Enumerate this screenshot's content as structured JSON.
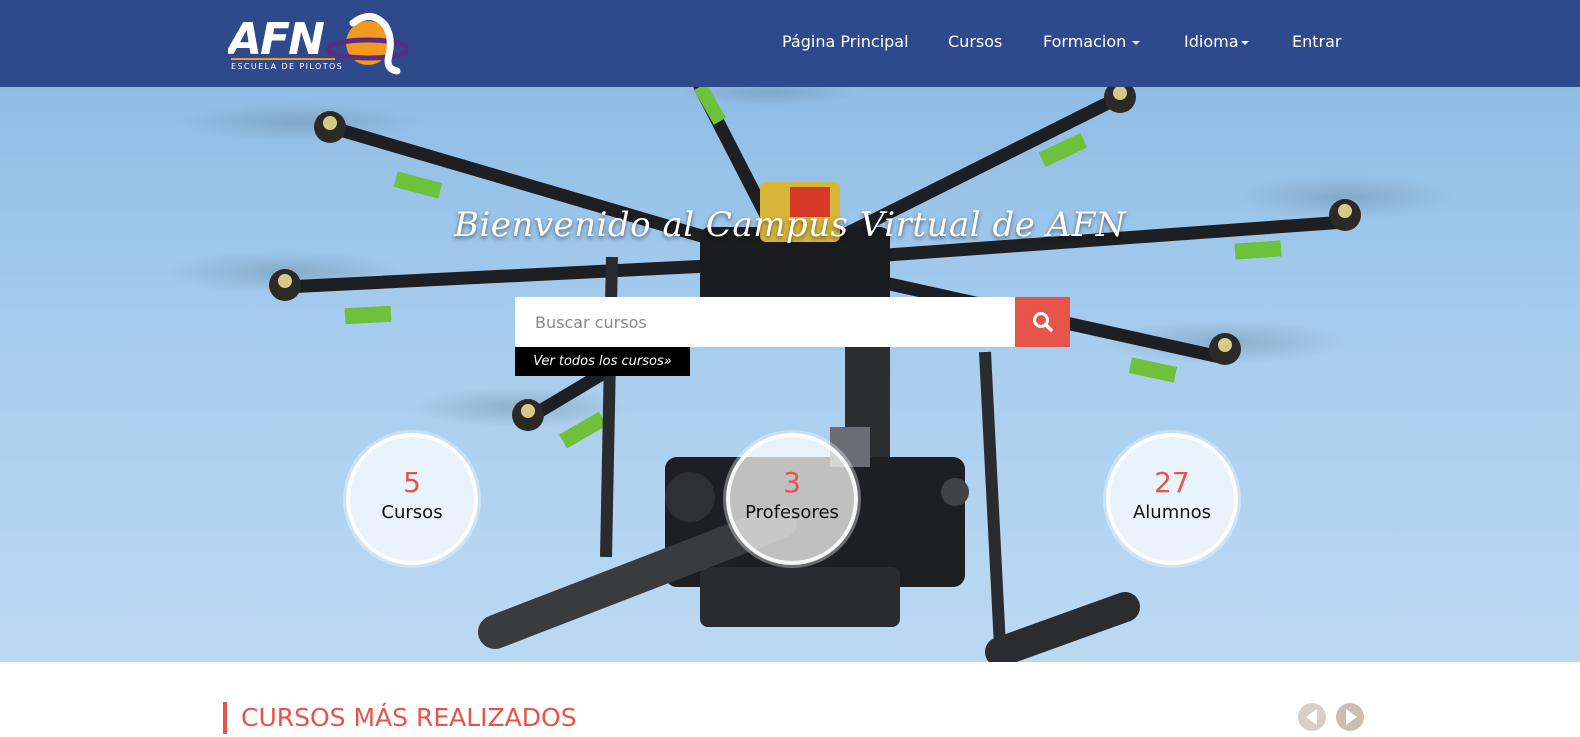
{
  "header": {
    "logo_text": "AFN",
    "logo_subtext": "ESCUELA DE PILOTOS",
    "nav": [
      {
        "label": "Página Principal"
      },
      {
        "label": "Cursos"
      },
      {
        "label": "Formacion"
      },
      {
        "label": "Idioma"
      },
      {
        "label": "Entrar"
      }
    ]
  },
  "hero": {
    "title": "Bienvenido al Campus Virtual de AFN",
    "search": {
      "placeholder": "Buscar cursos",
      "button_icon": "search-icon"
    },
    "view_all_link": "Ver todos los cursos»",
    "stats": [
      {
        "number": "5",
        "label": "Cursos"
      },
      {
        "number": "3",
        "label": "Profesores"
      },
      {
        "number": "27",
        "label": "Alumnos"
      }
    ]
  },
  "section": {
    "title": "CURSOS MÁS REALIZADOS",
    "prev_icon": "chevron-left-icon",
    "next_icon": "chevron-right-icon"
  },
  "colors": {
    "header_bg": "#2e4a8c",
    "accent": "#e6544a",
    "sky": "#a7cdee"
  }
}
